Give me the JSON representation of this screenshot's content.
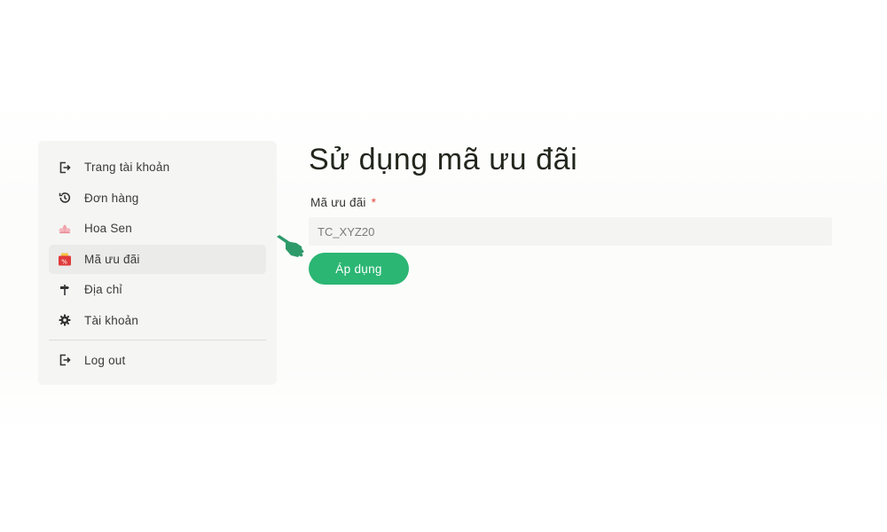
{
  "sidebar": {
    "items": [
      {
        "label": "Trang tài khoản",
        "icon": "logout-arrow-icon"
      },
      {
        "label": "Đơn hàng",
        "icon": "history-icon"
      },
      {
        "label": "Hoa Sen",
        "icon": "lotus-icon"
      },
      {
        "label": "Mã ưu đãi",
        "icon": "voucher-wallet-icon",
        "active": true
      },
      {
        "label": "Địa chỉ",
        "icon": "signpost-icon"
      },
      {
        "label": "Tài khoản",
        "icon": "gear-icon"
      }
    ],
    "logout_label": "Log out"
  },
  "main": {
    "title": "Sử dụng mã ưu đãi",
    "field_label": "Mã ưu đãi",
    "required_mark": "*",
    "input_value": "TC_XYZ20",
    "apply_label": "Áp dụng"
  },
  "colors": {
    "accent": "#2bb673",
    "required": "#e0483c",
    "sidebar_bg": "#f5f5f4",
    "active_bg": "#ebebea"
  }
}
